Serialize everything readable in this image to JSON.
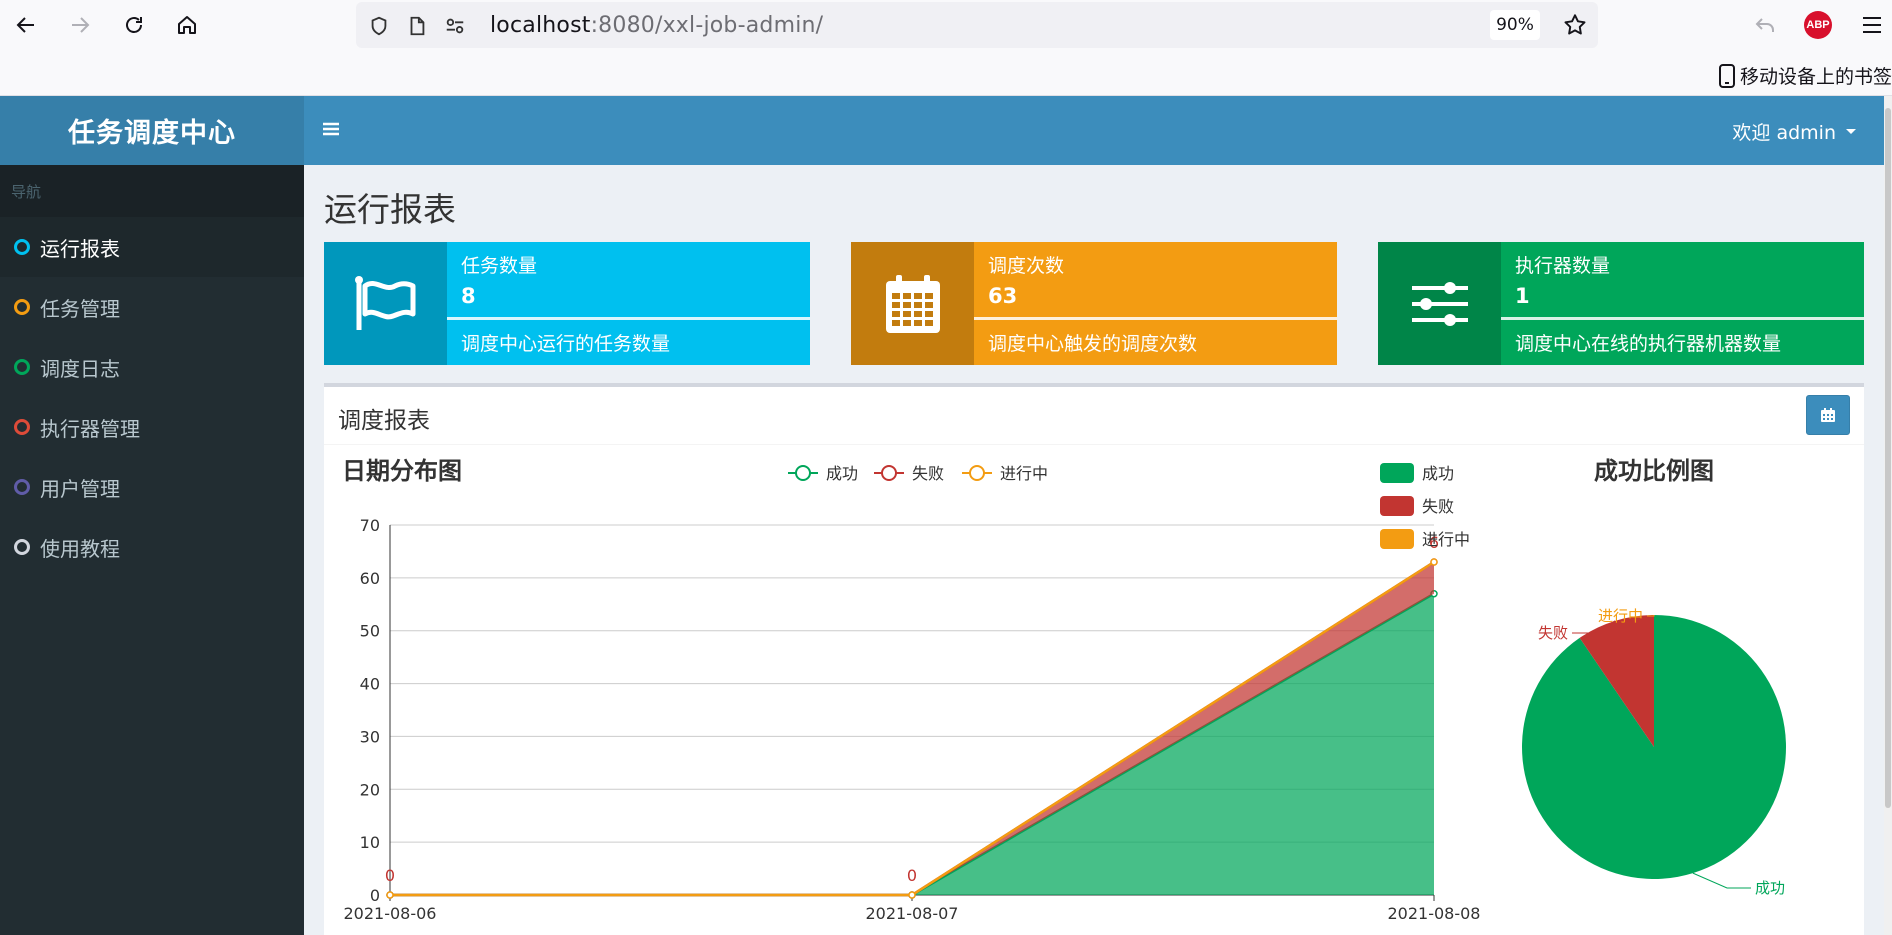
{
  "browser": {
    "url_host": "localhost",
    "url_rest": ":8080/xxl-job-admin/",
    "zoom": "90%",
    "bookmark_label": "移动设备上的书签",
    "abp_label": "ABP"
  },
  "header": {
    "logo": "任务调度中心",
    "welcome": "欢迎 admin"
  },
  "sidebar": {
    "header": "导航",
    "items": [
      {
        "label": "运行报表",
        "color": "#00c0ef"
      },
      {
        "label": "任务管理",
        "color": "#f39c12"
      },
      {
        "label": "调度日志",
        "color": "#00a65a"
      },
      {
        "label": "执行器管理",
        "color": "#dd4b39"
      },
      {
        "label": "用户管理",
        "color": "#605ca8"
      },
      {
        "label": "使用教程",
        "color": "#d2d6de"
      }
    ]
  },
  "page": {
    "title": "运行报表",
    "info_boxes": [
      {
        "label": "任务数量",
        "number": "8",
        "desc": "调度中心运行的任务数量",
        "color": "#00c0ef",
        "icon_bg": "#0097bc",
        "icon": "flag-icon"
      },
      {
        "label": "调度次数",
        "number": "63",
        "desc": "调度中心触发的调度次数",
        "color": "#f39c12",
        "icon_bg": "#c27c0e",
        "icon": "calendar-icon"
      },
      {
        "label": "执行器数量",
        "number": "1",
        "desc": "调度中心在线的执行器机器数量",
        "color": "#00a65a",
        "icon_bg": "#008548",
        "icon": "sliders-icon"
      }
    ],
    "report_title": "调度报表"
  },
  "chart_data": [
    {
      "type": "area",
      "title": "日期分布图",
      "stacked": true,
      "categories": [
        "2021-08-06",
        "2021-08-07",
        "2021-08-08"
      ],
      "series": [
        {
          "name": "成功",
          "values": [
            0,
            0,
            57
          ],
          "color": "#00a65a"
        },
        {
          "name": "失败",
          "values": [
            0,
            0,
            6
          ],
          "color": "#c23531"
        },
        {
          "name": "进行中",
          "values": [
            0,
            0,
            0
          ],
          "color": "#f39c12"
        }
      ],
      "data_labels": [
        "0",
        "0",
        "6"
      ],
      "ylim": [
        0,
        70
      ],
      "yticks": [
        0,
        10,
        20,
        30,
        40,
        50,
        60,
        70
      ],
      "grid": true,
      "legend": "top-center"
    },
    {
      "type": "pie",
      "title": "成功比例图",
      "slices": [
        {
          "name": "成功",
          "value": 57,
          "color": "#00a65a"
        },
        {
          "name": "失败",
          "value": 6,
          "color": "#c23531"
        },
        {
          "name": "进行中",
          "value": 0,
          "color": "#f39c12"
        }
      ],
      "legend": "top-left"
    }
  ]
}
